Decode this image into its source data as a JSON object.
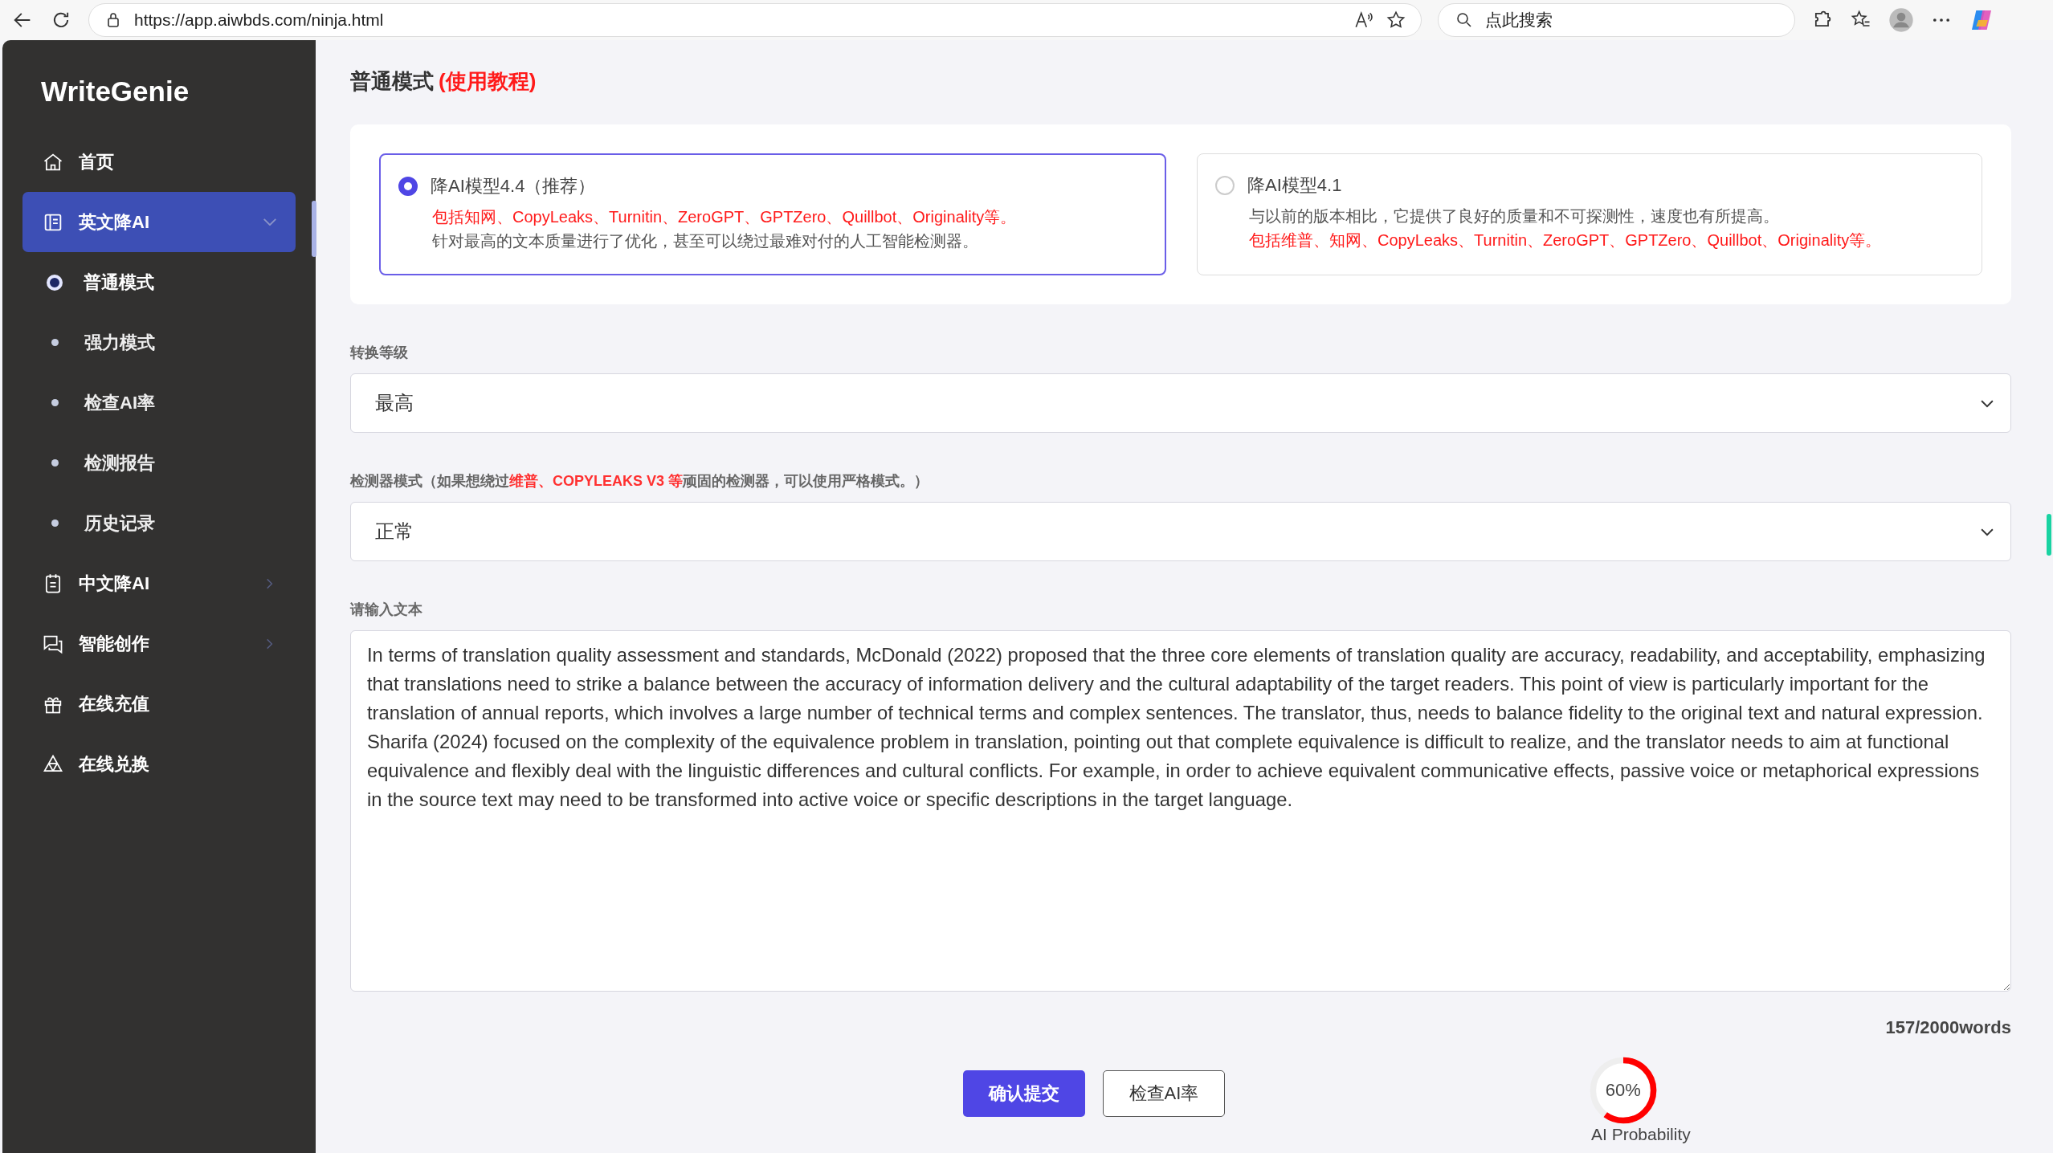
{
  "browser": {
    "url": "https://app.aiwbds.com/ninja.html",
    "search_placeholder": "点此搜索"
  },
  "sidebar": {
    "logo": "WriteGenie",
    "items": [
      {
        "label": "首页",
        "selected": false
      },
      {
        "label": "英文降AI",
        "selected": true,
        "expanded": true,
        "children": [
          {
            "label": "普通模式",
            "selected": true
          },
          {
            "label": "强力模式",
            "selected": false
          },
          {
            "label": "检查AI率",
            "selected": false
          },
          {
            "label": "检测报告",
            "selected": false
          },
          {
            "label": "历史记录",
            "selected": false
          }
        ]
      },
      {
        "label": "中文降AI",
        "selected": false,
        "expanded": false
      },
      {
        "label": "智能创作",
        "selected": false,
        "expanded": false
      },
      {
        "label": "在线充值",
        "selected": false
      },
      {
        "label": "在线兑换",
        "selected": false
      }
    ]
  },
  "page": {
    "title": "普通模式",
    "tutorial_link": "(使用教程)"
  },
  "models": [
    {
      "title": "降AI模型4.4（推荐）",
      "selected": true,
      "lines": [
        {
          "kind": "highlight",
          "text": "包括知网、CopyLeaks、Turnitin、ZeroGPT、GPTZero、Quillbot、Originality等。"
        },
        {
          "kind": "note",
          "text": "针对最高的文本质量进行了优化，甚至可以绕过最难对付的人工智能检测器。"
        }
      ]
    },
    {
      "title": "降AI模型4.1",
      "selected": false,
      "lines": [
        {
          "kind": "note",
          "text": "与以前的版本相比，它提供了良好的质量和不可探测性，速度也有所提高。"
        },
        {
          "kind": "highlight",
          "text": "包括维普、知网、CopyLeaks、Turnitin、ZeroGPT、GPTZero、Quillbot、Originality等。"
        }
      ]
    }
  ],
  "conversion_level": {
    "label": "转换等级",
    "value": "最高"
  },
  "detector_mode": {
    "label": "检测器模式（如果想绕过**维普、COPYLEAKS V3 等**顽固的检测器，可以使用严格模式。）",
    "value": "正常"
  },
  "input": {
    "label": "请输入文本",
    "value": "In terms of translation quality assessment and standards, McDonald (2022) proposed that the three core elements of translation quality are accuracy, readability, and acceptability, emphasizing that translations need to strike a balance between the accuracy of information delivery and the cultural adaptability of the target readers. This point of view is particularly important for the translation of annual reports, which involves a large number of technical terms and complex sentences. The translator, thus, needs to balance fidelity to the original text and natural expression. Sharifa (2024) focused on the complexity of the equivalence problem in translation, pointing out that complete equivalence is difficult to realize, and the translator needs to aim at functional equivalence and flexibly deal with the linguistic differences and cultural conflicts. For example, in order to achieve equivalent communicative effects, passive voice or metaphorical expressions in the source text may need to be transformed into active voice or specific descriptions in the target language.",
    "word_count": "157/2000words"
  },
  "buttons": [
    {
      "label": "确认提交",
      "kind": "primary"
    },
    {
      "label": "检查AI率",
      "kind": "secondary"
    }
  ],
  "ai_probability": {
    "reading": "60%",
    "level": 0.6,
    "caption": "AI Probability"
  }
}
